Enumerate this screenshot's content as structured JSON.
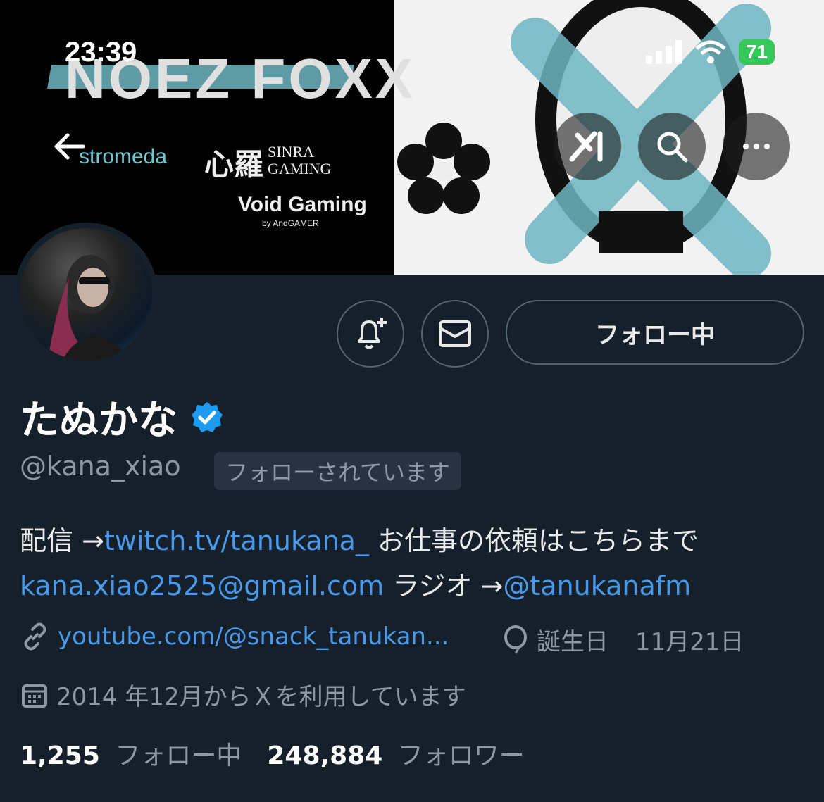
{
  "status_bar": {
    "time": "23:39",
    "battery": "71"
  },
  "banner": {
    "title": "NOEZ FOXX",
    "sponsor_1": "stromeda",
    "sponsor_2_kanji": "心羅",
    "sponsor_2_name_line1": "SINRA",
    "sponsor_2_name_line2": "GAMING",
    "sponsor_3": "Void Gaming",
    "sponsor_3_sub": "by AndGAMER"
  },
  "profile": {
    "name": "たぬかな",
    "handle": "@kana_xiao",
    "follows_you": "フォローされています",
    "follow_button": "フォロー中",
    "bio": {
      "line1_prefix": "配信 →",
      "line1_link": "twitch.tv/tanukana_",
      "line1_suffix": " お仕事の依頼はこちらまで",
      "line2_email": "kana.xiao2525@gmail.com",
      "line2_middle": " ラジオ →",
      "line2_mention": "@tanukanafm"
    },
    "website": "youtube.com/@snack_tanukan...",
    "birthday_label": "誕生日",
    "birthday_value": "11月21日",
    "joined": "2014 年12月からＸを利用しています",
    "following_count": "1,255",
    "following_label": "フォロー中",
    "followers_count": "248,884",
    "followers_label": "フォロワー"
  },
  "colors": {
    "background": "#15202b",
    "link": "#4a99e9",
    "verified": "#1d9bf0",
    "muted": "#8b98a5"
  }
}
